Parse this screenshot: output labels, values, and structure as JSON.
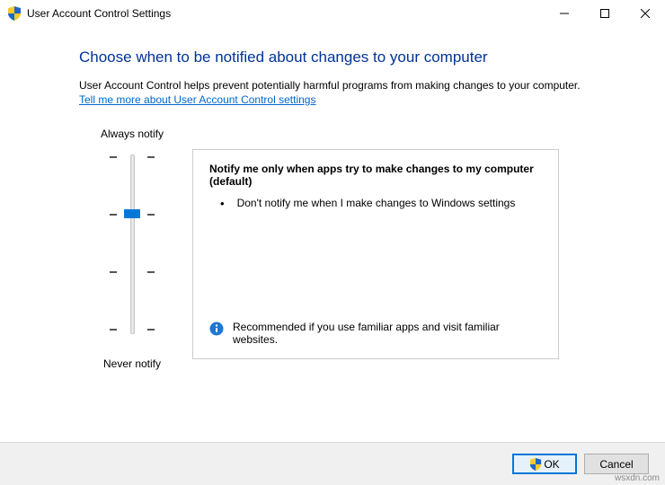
{
  "window": {
    "title": "User Account Control Settings"
  },
  "main": {
    "heading": "Choose when to be notified about changes to your computer",
    "description": "User Account Control helps prevent potentially harmful programs from making changes to your computer.",
    "link": "Tell me more about User Account Control settings"
  },
  "slider": {
    "top_label": "Always notify",
    "bottom_label": "Never notify",
    "levels": 4,
    "current_level": 2
  },
  "panel": {
    "title": "Notify me only when apps try to make changes to my computer (default)",
    "bullets": [
      "Don't notify me when I make changes to Windows settings"
    ],
    "recommendation": "Recommended if you use familiar apps and visit familiar websites."
  },
  "footer": {
    "ok_label": "OK",
    "cancel_label": "Cancel"
  },
  "watermark": "wsxdn.com"
}
